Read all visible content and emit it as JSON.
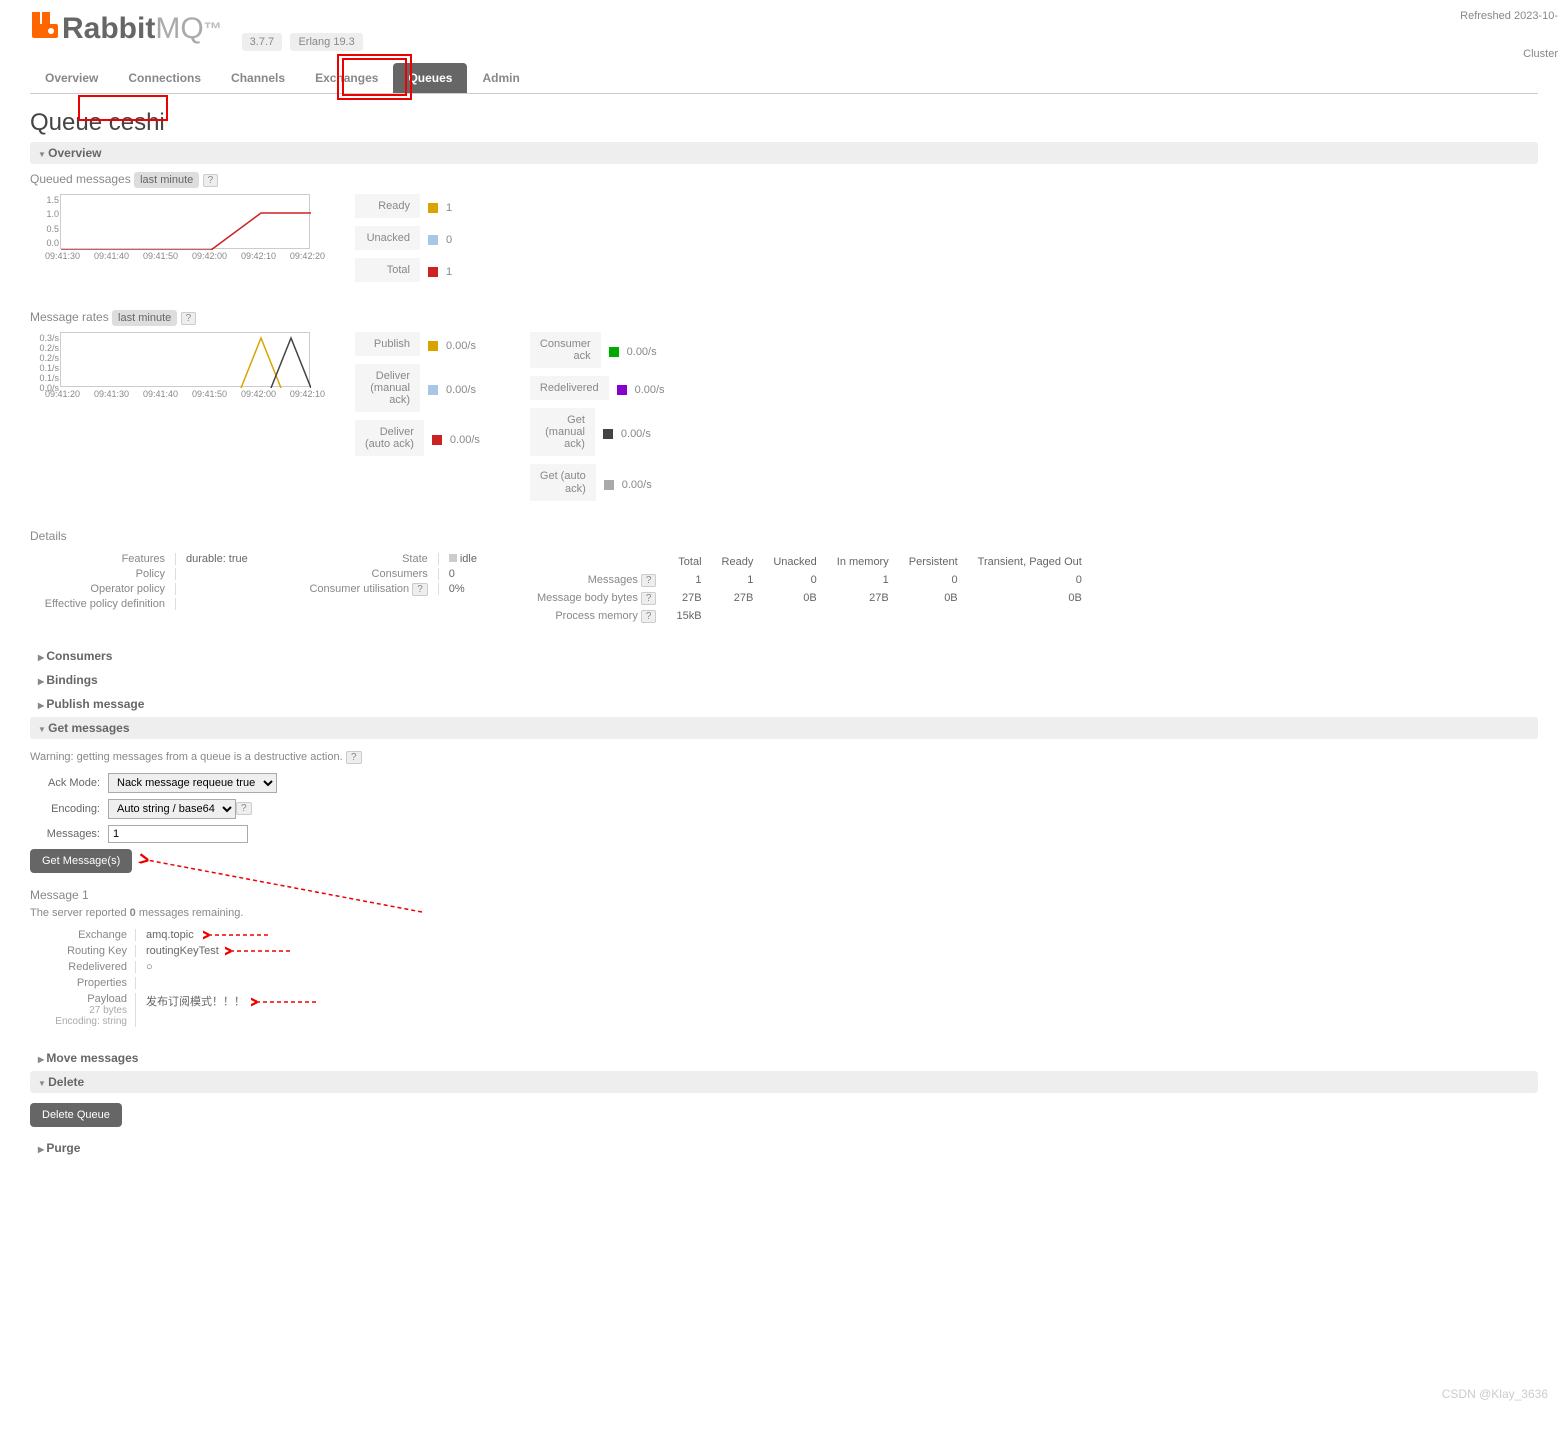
{
  "logo_prefix": "Rabbit",
  "logo_suffix": "MQ",
  "version": "3.7.7",
  "erlang": "Erlang 19.3",
  "refreshed": "Refreshed 2023-10-",
  "cluster": "Cluster",
  "tabs": [
    "Overview",
    "Connections",
    "Channels",
    "Exchanges",
    "Queues",
    "Admin"
  ],
  "page_title_prefix": "Queue ",
  "page_title_name": "ceshi",
  "sections": {
    "overview": "Overview",
    "consumers": "Consumers",
    "bindings": "Bindings",
    "publish": "Publish message",
    "get": "Get messages",
    "move": "Move messages",
    "delete": "Delete",
    "purge": "Purge"
  },
  "queued_msgs_label": "Queued messages",
  "msg_rates_label": "Message rates",
  "last_minute": "last minute",
  "chart_data": [
    {
      "type": "line",
      "title": "Queued messages",
      "x_ticks": [
        "09:41:30",
        "09:41:40",
        "09:41:50",
        "09:42:00",
        "09:42:10",
        "09:42:20"
      ],
      "y_ticks": [
        "1.5",
        "1.0",
        "0.5",
        "0.0"
      ],
      "series": [
        {
          "name": "Ready",
          "color": "#d9a400",
          "points": [
            [
              0,
              0
            ],
            [
              150,
              0
            ],
            [
              200,
              1
            ],
            [
              250,
              1
            ]
          ]
        },
        {
          "name": "Unacked",
          "color": "#a7c7e7",
          "points": []
        },
        {
          "name": "Total",
          "color": "#c22",
          "points": [
            [
              0,
              0
            ],
            [
              150,
              0
            ],
            [
              200,
              1
            ],
            [
              250,
              1
            ]
          ]
        }
      ],
      "ylim": [
        0,
        1.5
      ]
    },
    {
      "type": "line",
      "title": "Message rates",
      "x_ticks": [
        "09:41:20",
        "09:41:30",
        "09:41:40",
        "09:41:50",
        "09:42:00",
        "09:42:10"
      ],
      "y_ticks": [
        "0.3/s",
        "0.2/s",
        "0.2/s",
        "0.1/s",
        "0.1/s",
        "0.0/s"
      ],
      "series": [
        {
          "name": "Publish",
          "color": "#d9a400"
        },
        {
          "name": "Deliver (manual ack)",
          "color": "#a7c7e7"
        },
        {
          "name": "Deliver (auto ack)",
          "color": "#c22"
        },
        {
          "name": "Consumer ack",
          "color": "#0a0"
        },
        {
          "name": "Redelivered",
          "color": "#80c"
        },
        {
          "name": "Get (manual ack)",
          "color": "#444"
        },
        {
          "name": "Get (auto ack)",
          "color": "#aaa"
        }
      ],
      "ylim": [
        0,
        0.3
      ]
    }
  ],
  "legend1": [
    {
      "label": "Ready",
      "color": "#d9a400",
      "value": "1"
    },
    {
      "label": "Unacked",
      "color": "#a7c7e7",
      "value": "0"
    },
    {
      "label": "Total",
      "color": "#c22",
      "value": "1"
    }
  ],
  "legend2a": [
    {
      "label": "Publish",
      "color": "#d9a400",
      "value": "0.00/s"
    },
    {
      "label": "Deliver (manual ack)",
      "color": "#a7c7e7",
      "value": "0.00/s"
    },
    {
      "label": "Deliver (auto ack)",
      "color": "#c22",
      "value": "0.00/s"
    }
  ],
  "legend2b": [
    {
      "label": "Consumer ack",
      "color": "#0a0",
      "value": "0.00/s"
    },
    {
      "label": "Redelivered",
      "color": "#80c",
      "value": "0.00/s"
    },
    {
      "label": "Get (manual ack)",
      "color": "#444",
      "value": "0.00/s"
    },
    {
      "label": "Get (auto ack)",
      "color": "#aaa",
      "value": "0.00/s"
    }
  ],
  "details_label": "Details",
  "details_left": {
    "features_lbl": "Features",
    "features_val": "durable: true",
    "policy_lbl": "Policy",
    "policy_val": "",
    "oppolicy_lbl": "Operator policy",
    "oppolicy_val": "",
    "effpolicy_lbl": "Effective policy definition",
    "effpolicy_val": ""
  },
  "details_mid": {
    "state_lbl": "State",
    "state_val": "idle",
    "consumers_lbl": "Consumers",
    "consumers_val": "0",
    "util_lbl": "Consumer utilisation",
    "util_val": "0%"
  },
  "stats_headers": [
    "Total",
    "Ready",
    "Unacked",
    "In memory",
    "Persistent",
    "Transient, Paged Out"
  ],
  "stats_rows": [
    {
      "label": "Messages",
      "vals": [
        "1",
        "1",
        "0",
        "1",
        "0",
        "0"
      ]
    },
    {
      "label": "Message body bytes",
      "vals": [
        "27B",
        "27B",
        "0B",
        "27B",
        "0B",
        "0B"
      ]
    },
    {
      "label": "Process memory",
      "vals": [
        "15kB",
        "",
        "",
        "",
        "",
        ""
      ]
    }
  ],
  "get_warning": "Warning: getting messages from a queue is a destructive action.",
  "ack_mode_lbl": "Ack Mode:",
  "ack_mode_val": "Nack message requeue true",
  "encoding_lbl": "Encoding:",
  "encoding_val": "Auto string / base64",
  "messages_lbl": "Messages:",
  "messages_val": "1",
  "get_btn": "Get Message(s)",
  "msg_header": "Message 1",
  "server_reported_pre": "The server reported ",
  "server_reported_count": "0",
  "server_reported_post": " messages remaining.",
  "msg_exchange_lbl": "Exchange",
  "msg_exchange_val": "amq.topic",
  "msg_rk_lbl": "Routing Key",
  "msg_rk_val": "routingKeyTest",
  "msg_redeliv_lbl": "Redelivered",
  "msg_redeliv_val": "○",
  "msg_props_lbl": "Properties",
  "msg_props_val": "",
  "msg_payload_lbl": "Payload",
  "msg_payload_bytes": "27 bytes",
  "msg_payload_enc": "Encoding: string",
  "msg_payload_val": "发布订阅模式！！！",
  "delete_btn": "Delete Queue",
  "watermark": "CSDN @Klay_3636"
}
